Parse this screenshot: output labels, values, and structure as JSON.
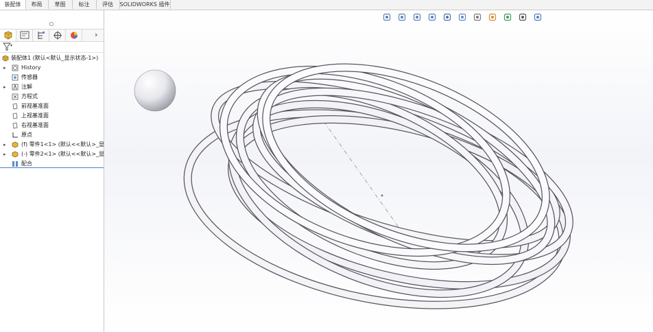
{
  "tabs": [
    {
      "label": "装配体",
      "active": true
    },
    {
      "label": "布局",
      "active": false
    },
    {
      "label": "草图",
      "active": false
    },
    {
      "label": "标注",
      "active": false
    },
    {
      "label": "评估",
      "active": false
    },
    {
      "label": "SOLIDWORKS 插件",
      "active": false
    }
  ],
  "panel": {
    "more_arrow": "›",
    "filter_caret": "▾"
  },
  "tree": {
    "root": "装配体1  (默认<默认_显示状态-1>)",
    "items": [
      {
        "label": "History",
        "icon": "history-icon",
        "expandable": true
      },
      {
        "label": "传感器",
        "icon": "sensor-icon",
        "expandable": false
      },
      {
        "label": "注解",
        "icon": "annotation-icon",
        "expandable": true
      },
      {
        "label": "方程式",
        "icon": "equation-icon",
        "expandable": false
      },
      {
        "label": "前视基准面",
        "icon": "plane-icon",
        "expandable": false
      },
      {
        "label": "上视基准面",
        "icon": "plane-icon",
        "expandable": false
      },
      {
        "label": "右视基准面",
        "icon": "plane-icon",
        "expandable": false
      },
      {
        "label": "原点",
        "icon": "origin-icon",
        "expandable": false
      },
      {
        "label": "(f) 零件1<1> (默认<<默认>_显示",
        "icon": "part-icon",
        "expandable": true
      },
      {
        "label": "(-) 零件2<1> (默认<<默认>_显示",
        "icon": "part-icon",
        "expandable": true
      },
      {
        "label": "配合",
        "icon": "mates-icon",
        "expandable": false
      }
    ]
  },
  "viewport": {
    "hud_icons": [
      "zoom-to-fit-icon",
      "zoom-to-area-icon",
      "previous-view-icon",
      "section-view-icon",
      "view-orientation-icon",
      "display-style-icon",
      "hide-show-icon",
      "edit-appearance-icon",
      "apply-scene-icon",
      "view-settings-icon",
      "display-pane-icon"
    ]
  },
  "colors": {
    "accent": "#4a7fc0",
    "part_yellow": "#e8b640"
  }
}
